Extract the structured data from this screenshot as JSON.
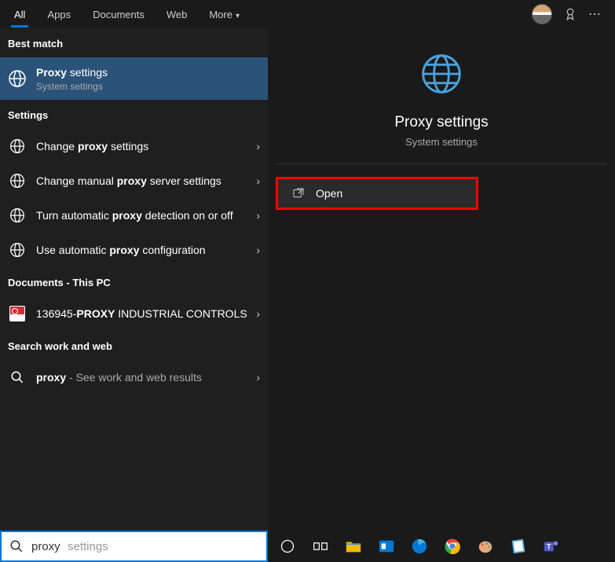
{
  "tabs": {
    "all": "All",
    "apps": "Apps",
    "documents": "Documents",
    "web": "Web",
    "more": "More"
  },
  "sections": {
    "best_match": "Best match",
    "settings": "Settings",
    "documents": "Documents - This PC",
    "work_web": "Search work and web"
  },
  "best_match": {
    "title_bold": "Proxy",
    "title_rest": " settings",
    "subtitle": "System settings"
  },
  "settings_items": [
    {
      "pre": "Change ",
      "bold": "proxy",
      "post": " settings"
    },
    {
      "pre": "Change manual ",
      "bold": "proxy",
      "post": " server settings"
    },
    {
      "pre": "Turn automatic ",
      "bold": "proxy",
      "post": " detection on or off"
    },
    {
      "pre": "Use automatic ",
      "bold": "proxy",
      "post": " configuration"
    }
  ],
  "document_item": {
    "pre": "136945-",
    "bold": "PROXY",
    "post": " INDUSTRIAL CONTROLS"
  },
  "web_item": {
    "pre": "",
    "bold": "proxy",
    "post": " - See work and web results"
  },
  "detail": {
    "title": "Proxy settings",
    "subtitle": "System settings",
    "open_label": "Open"
  },
  "search": {
    "value": "proxy",
    "ghost": "settings"
  }
}
